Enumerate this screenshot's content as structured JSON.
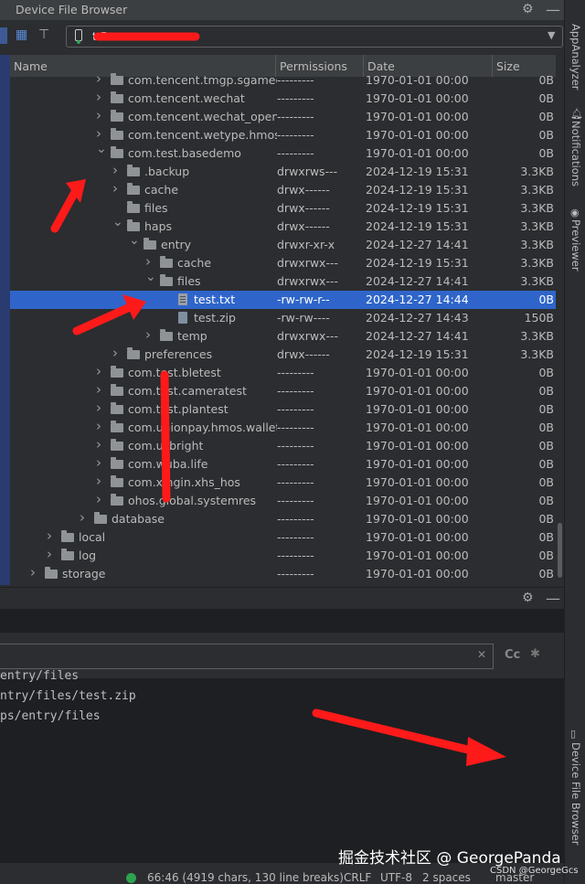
{
  "window": {
    "title": "Device File Browser"
  },
  "device": {
    "selected": "t                        5"
  },
  "columns": {
    "name": "Name",
    "permissions": "Permissions",
    "date": "Date",
    "size": "Size"
  },
  "rows": [
    {
      "name": "com.tencent.tmgp.sgamece...",
      "perm": "---------",
      "date": "1970-01-01 00:00",
      "size": "0B",
      "indent": 0,
      "expanded": false,
      "type": "folder",
      "has_children": true
    },
    {
      "name": "com.tencent.wechat",
      "perm": "---------",
      "date": "1970-01-01 00:00",
      "size": "0B",
      "indent": 0,
      "expanded": false,
      "type": "folder",
      "has_children": true
    },
    {
      "name": "com.tencent.wechat_openap",
      "perm": "---------",
      "date": "1970-01-01 00:00",
      "size": "0B",
      "indent": 0,
      "expanded": false,
      "type": "folder",
      "has_children": true
    },
    {
      "name": "com.tencent.wetype.hmos",
      "perm": "---------",
      "date": "1970-01-01 00:00",
      "size": "0B",
      "indent": 0,
      "expanded": false,
      "type": "folder",
      "has_children": true
    },
    {
      "name": "com.test.basedemo",
      "perm": "---------",
      "date": "1970-01-01 00:00",
      "size": "0B",
      "indent": 0,
      "expanded": true,
      "type": "folder",
      "has_children": true
    },
    {
      "name": ".backup",
      "perm": "drwxrws---",
      "date": "2024-12-19 15:31",
      "size": "3.3KB",
      "indent": 1,
      "expanded": false,
      "type": "folder",
      "has_children": true
    },
    {
      "name": "cache",
      "perm": "drwx------",
      "date": "2024-12-19 15:31",
      "size": "3.3KB",
      "indent": 1,
      "expanded": false,
      "type": "folder",
      "has_children": true
    },
    {
      "name": "files",
      "perm": "drwx------",
      "date": "2024-12-19 15:31",
      "size": "3.3KB",
      "indent": 1,
      "expanded": false,
      "type": "folder",
      "has_children": false
    },
    {
      "name": "haps",
      "perm": "drwx------",
      "date": "2024-12-19 15:31",
      "size": "3.3KB",
      "indent": 1,
      "expanded": true,
      "type": "folder",
      "has_children": true
    },
    {
      "name": "entry",
      "perm": "drwxr-xr-x",
      "date": "2024-12-27 14:41",
      "size": "3.3KB",
      "indent": 2,
      "expanded": true,
      "type": "folder",
      "has_children": true
    },
    {
      "name": "cache",
      "perm": "drwxrwx---",
      "date": "2024-12-19 15:31",
      "size": "3.3KB",
      "indent": 3,
      "expanded": false,
      "type": "folder",
      "has_children": true
    },
    {
      "name": "files",
      "perm": "drwxrwx---",
      "date": "2024-12-27 14:41",
      "size": "3.3KB",
      "indent": 3,
      "expanded": true,
      "type": "folder",
      "has_children": true
    },
    {
      "name": "test.txt",
      "perm": "-rw-rw-r--",
      "date": "2024-12-27 14:44",
      "size": "0B",
      "indent": 4,
      "expanded": false,
      "type": "file",
      "has_children": false,
      "selected": true
    },
    {
      "name": "test.zip",
      "perm": "-rw-rw----",
      "date": "2024-12-27 14:43",
      "size": "150B",
      "indent": 4,
      "expanded": false,
      "type": "zip",
      "has_children": false
    },
    {
      "name": "temp",
      "perm": "drwxrwx---",
      "date": "2024-12-27 14:41",
      "size": "3.3KB",
      "indent": 3,
      "expanded": false,
      "type": "folder",
      "has_children": true
    },
    {
      "name": "preferences",
      "perm": "drwx------",
      "date": "2024-12-19 15:31",
      "size": "3.3KB",
      "indent": 1,
      "expanded": false,
      "type": "folder",
      "has_children": true
    },
    {
      "name": "com.test.bletest",
      "perm": "---------",
      "date": "1970-01-01 00:00",
      "size": "0B",
      "indent": 0,
      "expanded": false,
      "type": "folder",
      "has_children": true
    },
    {
      "name": "com.test.cameratest",
      "perm": "---------",
      "date": "1970-01-01 00:00",
      "size": "0B",
      "indent": 0,
      "expanded": false,
      "type": "folder",
      "has_children": true
    },
    {
      "name": "com.test.plantest",
      "perm": "---------",
      "date": "1970-01-01 00:00",
      "size": "0B",
      "indent": 0,
      "expanded": false,
      "type": "folder",
      "has_children": true
    },
    {
      "name": "com.unionpay.hmos.wallet",
      "perm": "---------",
      "date": "1970-01-01 00:00",
      "size": "0B",
      "indent": 0,
      "expanded": false,
      "type": "folder",
      "has_children": true
    },
    {
      "name": "com.usbright",
      "perm": "---------",
      "date": "1970-01-01 00:00",
      "size": "0B",
      "indent": 0,
      "expanded": false,
      "type": "folder",
      "has_children": true
    },
    {
      "name": "com.wuba.life",
      "perm": "---------",
      "date": "1970-01-01 00:00",
      "size": "0B",
      "indent": 0,
      "expanded": false,
      "type": "folder",
      "has_children": true
    },
    {
      "name": "com.xingin.xhs_hos",
      "perm": "---------",
      "date": "1970-01-01 00:00",
      "size": "0B",
      "indent": 0,
      "expanded": false,
      "type": "folder",
      "has_children": true
    },
    {
      "name": "ohos.global.systemres",
      "perm": "---------",
      "date": "1970-01-01 00:00",
      "size": "0B",
      "indent": 0,
      "expanded": false,
      "type": "folder",
      "has_children": true
    },
    {
      "name": "database",
      "perm": "---------",
      "date": "1970-01-01 00:00",
      "size": "0B",
      "indent": -1,
      "expanded": false,
      "type": "folder",
      "has_children": true
    },
    {
      "name": "local",
      "perm": "---------",
      "date": "1970-01-01 00:00",
      "size": "0B",
      "indent": -3,
      "expanded": false,
      "type": "folder",
      "has_children": true
    },
    {
      "name": "log",
      "perm": "---------",
      "date": "1970-01-01 00:00",
      "size": "0B",
      "indent": -3,
      "expanded": false,
      "type": "folder",
      "has_children": true
    },
    {
      "name": "storage",
      "perm": "---------",
      "date": "1970-01-01 00:00",
      "size": "0B",
      "indent": -4,
      "expanded": false,
      "type": "folder",
      "has_children": true
    }
  ],
  "right_panel": {
    "app_analyzer": "AppAnalyzer",
    "notifications": "Notifications",
    "previewer": "Previewer",
    "device_file_browser": "Device File Browser"
  },
  "log": {
    "lines": [
      "entry/files",
      "ntry/files/test.zip",
      "ps/entry/files"
    ]
  },
  "search": {
    "regex_label": "Cc",
    "star": "✱"
  },
  "status": {
    "position": "66:46 (4919 chars, 130 line breaks)",
    "line_sep": "CRLF",
    "encoding": "UTF-8",
    "indent": "2 spaces",
    "branch": "master"
  },
  "watermark": {
    "main": "掘金技术社区 @ GeorgePanda",
    "sub": "CSDN @GeorgeGcs"
  },
  "colors": {
    "accent_selected": "#2f65ca",
    "annotation_red": "#ff1a1a",
    "status_green": "#2da44e"
  }
}
